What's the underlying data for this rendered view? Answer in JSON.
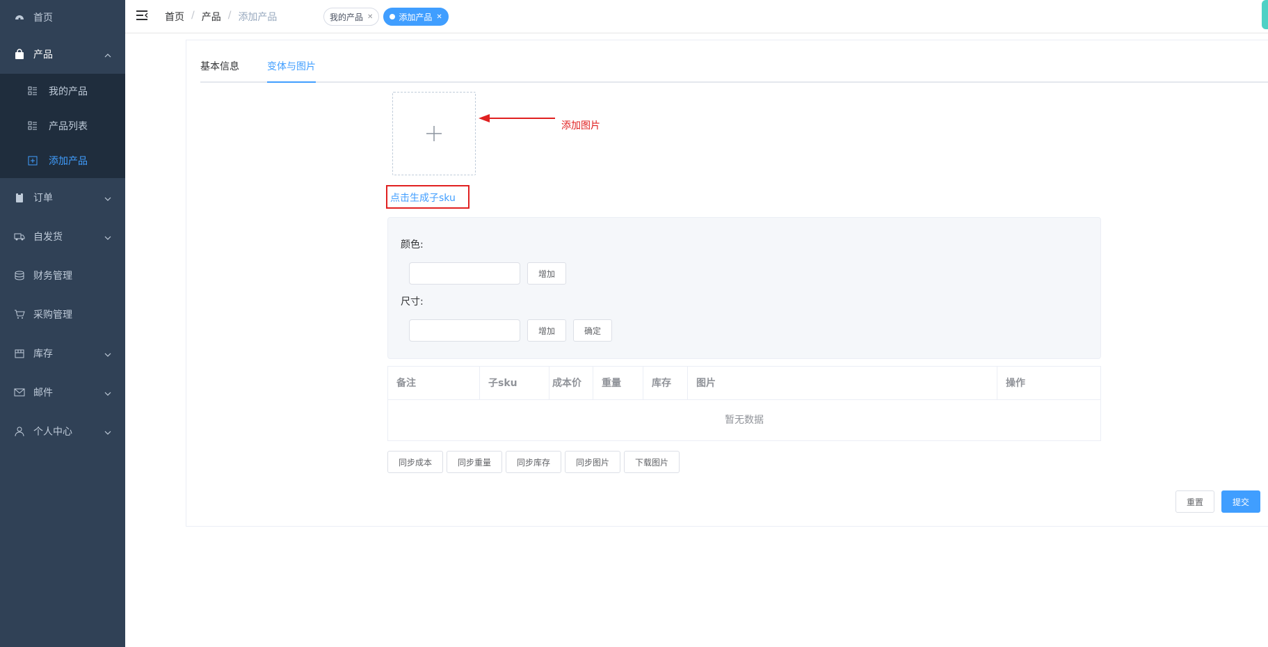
{
  "sidebar": {
    "items": [
      {
        "label": "首页",
        "icon": "dashboard-icon"
      },
      {
        "label": "产品",
        "icon": "bag-icon"
      },
      {
        "label": "订单",
        "icon": "clipboard-icon"
      },
      {
        "label": "自发货",
        "icon": "truck-icon"
      },
      {
        "label": "财务管理",
        "icon": "database-icon"
      },
      {
        "label": "采购管理",
        "icon": "cart-icon"
      },
      {
        "label": "库存",
        "icon": "box-icon"
      },
      {
        "label": "邮件",
        "icon": "mail-icon"
      },
      {
        "label": "个人中心",
        "icon": "user-icon"
      }
    ],
    "product_submenu": [
      {
        "label": "我的产品",
        "icon": "list-icon"
      },
      {
        "label": "产品列表",
        "icon": "list-icon"
      },
      {
        "label": "添加产品",
        "icon": "add-square-icon"
      }
    ],
    "colors": {
      "bg": "#304156",
      "sub_bg": "#1f2d3d",
      "text": "#bfcbd9",
      "active": "#409eff"
    }
  },
  "breadcrumb": [
    "首页",
    "产品",
    "添加产品"
  ],
  "tags": [
    {
      "label": "我的产品",
      "active": false
    },
    {
      "label": "添加产品",
      "active": true
    }
  ],
  "tabs": [
    "基本信息",
    "变体与图片"
  ],
  "annotation": "添加图片",
  "generate_link": "点击生成子sku",
  "attributes": {
    "color_label": "颜色:",
    "size_label": "尺寸:",
    "add": "增加",
    "confirm": "确定"
  },
  "table": {
    "columns": [
      "备注",
      "子sku",
      "成本价",
      "重量",
      "库存",
      "图片",
      "操作"
    ],
    "empty": "暂无数据"
  },
  "sync_buttons": [
    "同步成本",
    "同步重量",
    "同步库存",
    "同步图片",
    "下载图片"
  ],
  "footer": {
    "reset": "重置",
    "submit": "提交"
  }
}
